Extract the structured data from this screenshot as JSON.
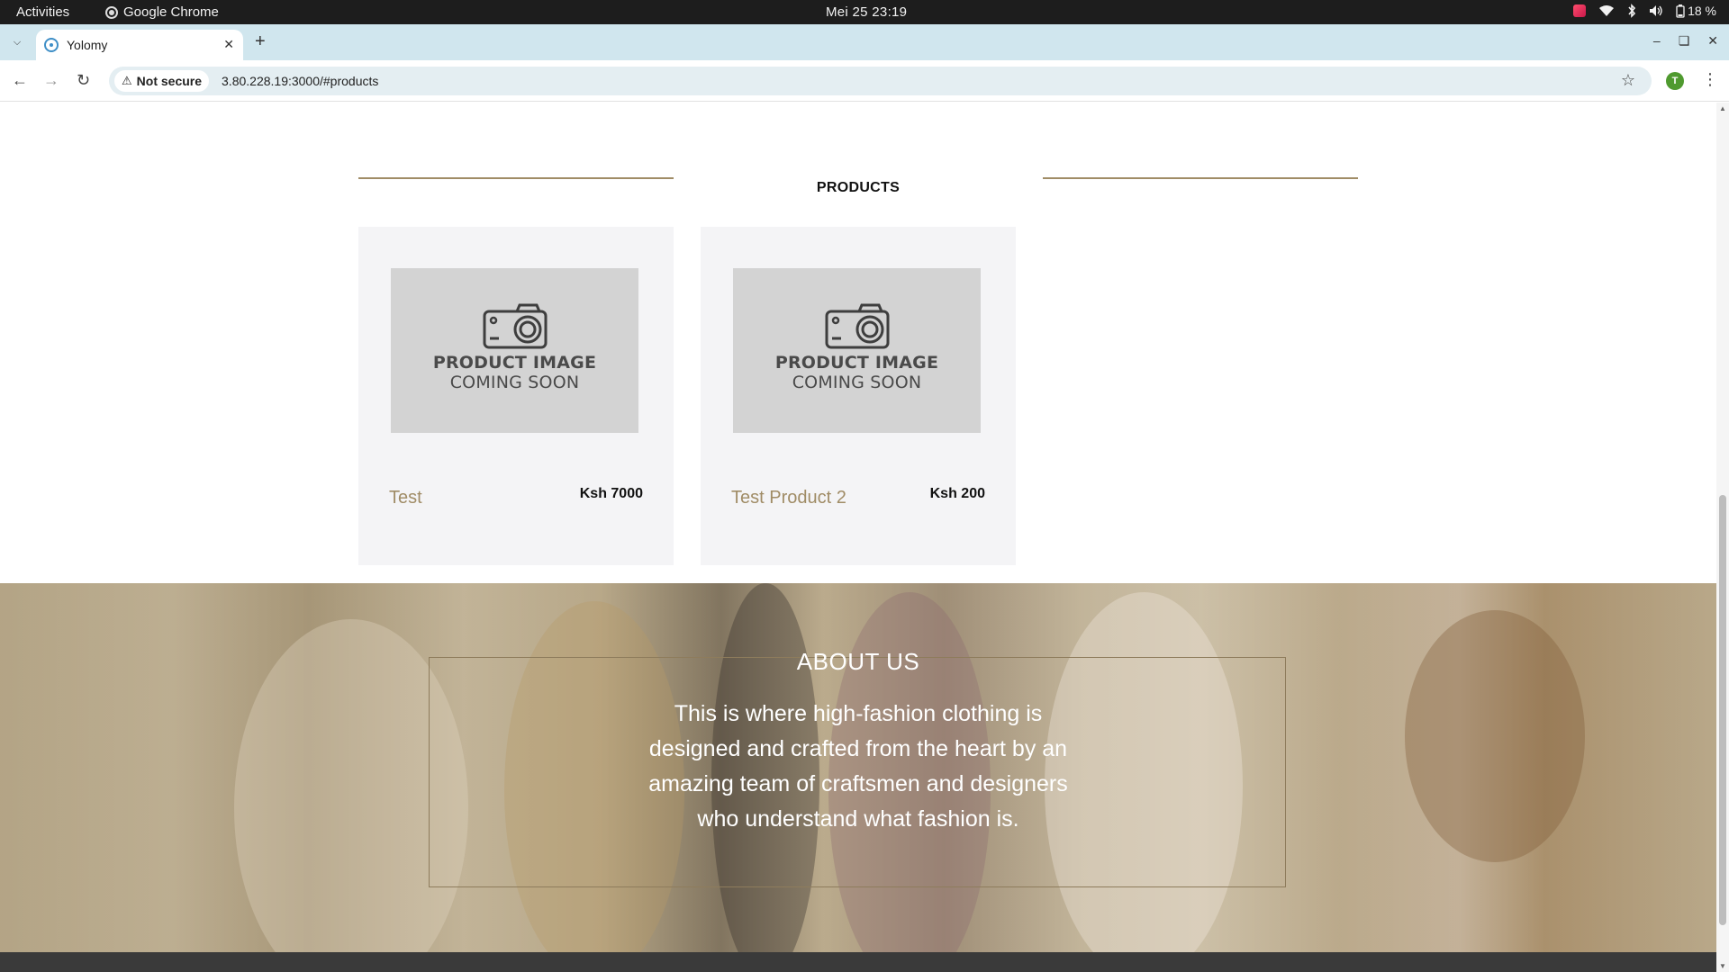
{
  "system_bar": {
    "activities": "Activities",
    "app_name": "Google Chrome",
    "clock": "Mei 25  23:19",
    "battery": "18 %"
  },
  "browser": {
    "tab_title": "Yolomy",
    "security_label": "Not secure",
    "url": "3.80.228.19:3000/#products",
    "profile_initial": "T"
  },
  "products_section": {
    "title": "PRODUCTS",
    "placeholder_line1": "PRODUCT IMAGE",
    "placeholder_line2": "COMING SOON",
    "items": [
      {
        "name": "Test",
        "price": "Ksh 7000"
      },
      {
        "name": "Test Product 2",
        "price": "Ksh 200"
      }
    ]
  },
  "about_section": {
    "title": "ABOUT US",
    "text": "This is where high-fashion clothing is designed and crafted from the heart by an amazing team of craftsmen and designers who understand what fashion is."
  },
  "colors": {
    "accent": "#a08c66",
    "card_bg": "#f4f4f6",
    "placeholder_bg": "#d3d3d3"
  }
}
